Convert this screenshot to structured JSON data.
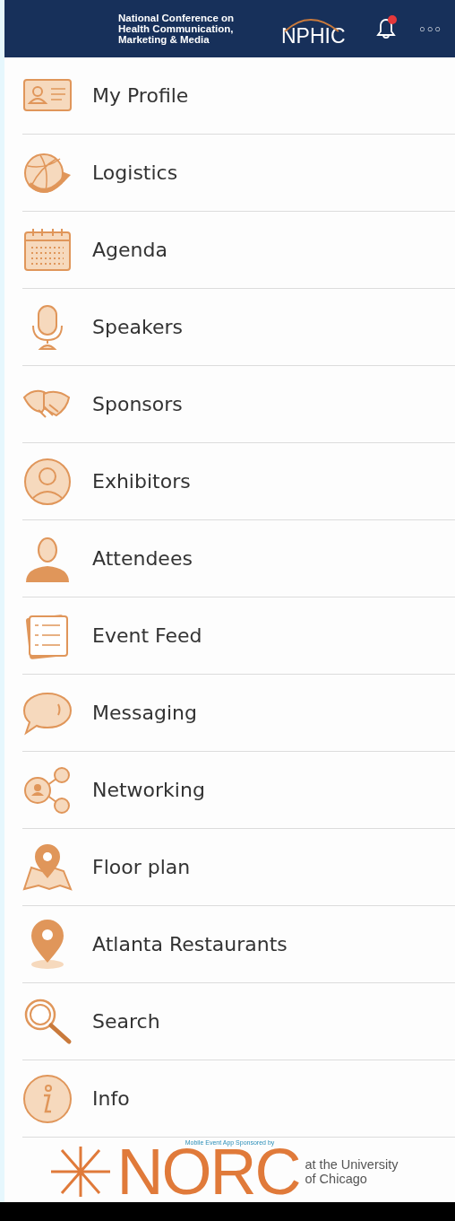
{
  "header": {
    "conference_title": "National Conference on Health Communication, Marketing & Media",
    "logo_text": "NPHIC",
    "notification": true,
    "more_label": "○○○"
  },
  "menu": [
    {
      "label": "My Profile"
    },
    {
      "label": "Logistics"
    },
    {
      "label": "Agenda"
    },
    {
      "label": "Speakers"
    },
    {
      "label": "Sponsors"
    },
    {
      "label": "Exhibitors"
    },
    {
      "label": "Attendees"
    },
    {
      "label": "Event Feed"
    },
    {
      "label": "Messaging"
    },
    {
      "label": "Networking"
    },
    {
      "label": "Floor plan"
    },
    {
      "label": "Atlanta Restaurants"
    },
    {
      "label": "Search"
    },
    {
      "label": "Info"
    }
  ],
  "footer": {
    "sponsor_caption": "Mobile Event App Sponsored by",
    "sponsor_name": "NORC",
    "sponsor_affiliation": "at the University of Chicago"
  }
}
